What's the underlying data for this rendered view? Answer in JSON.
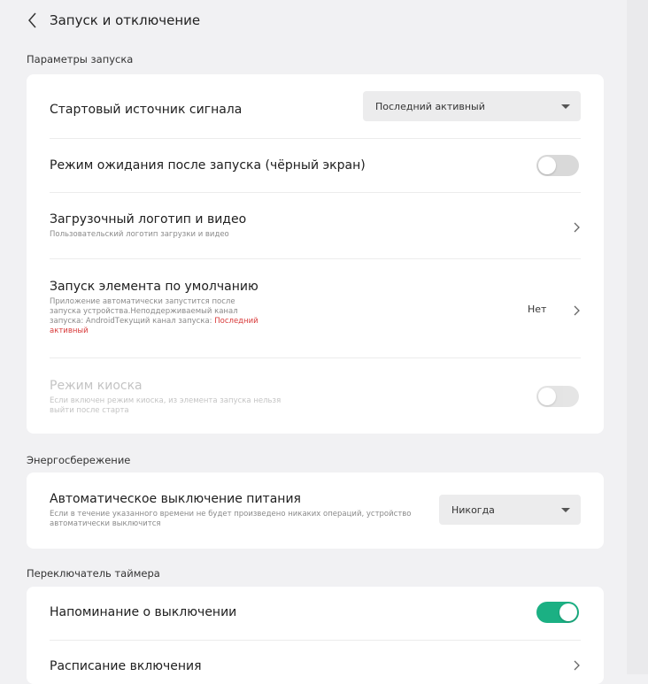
{
  "header": {
    "title": "Запуск и отключение"
  },
  "sections": {
    "startup": "Параметры запуска",
    "power": "Энергосбережение",
    "timer": "Переключатель таймера"
  },
  "startup": {
    "source": {
      "label": "Стартовый источник сигнала",
      "value": "Последний активный"
    },
    "standby": {
      "label": "Режим ожидания после запуска (чёрный экран)",
      "state": "off"
    },
    "logo": {
      "label": "Загрузочный логотип и видео",
      "desc": "Пользовательский логотип загрузки и видео"
    },
    "default_launch": {
      "label": "Запуск элемента по умолчанию",
      "desc": "Приложение автоматически запустится после запуска устройства.Неподдерживаемый канал запуска: AndroidТекущий канал запуска: ",
      "desc_highlight": "Последний активный",
      "value": "Нет"
    },
    "kiosk": {
      "label": "Режим киоска",
      "desc": "Если включен режим киоска, из элемента запуска нельзя выйти после старта",
      "state": "off"
    }
  },
  "power": {
    "auto_off": {
      "label": "Автоматическое выключение питания",
      "desc": "Если в течение указанного времени не будет произведено никаких операций, устройство автоматически выключится",
      "value": "Никогда"
    }
  },
  "timer": {
    "reminder": {
      "label": "Напоминание о выключении",
      "state": "on"
    },
    "schedule": {
      "label": "Расписание включения"
    }
  },
  "colors": {
    "accent": "#1bb083",
    "highlight": "#d83a3a"
  }
}
